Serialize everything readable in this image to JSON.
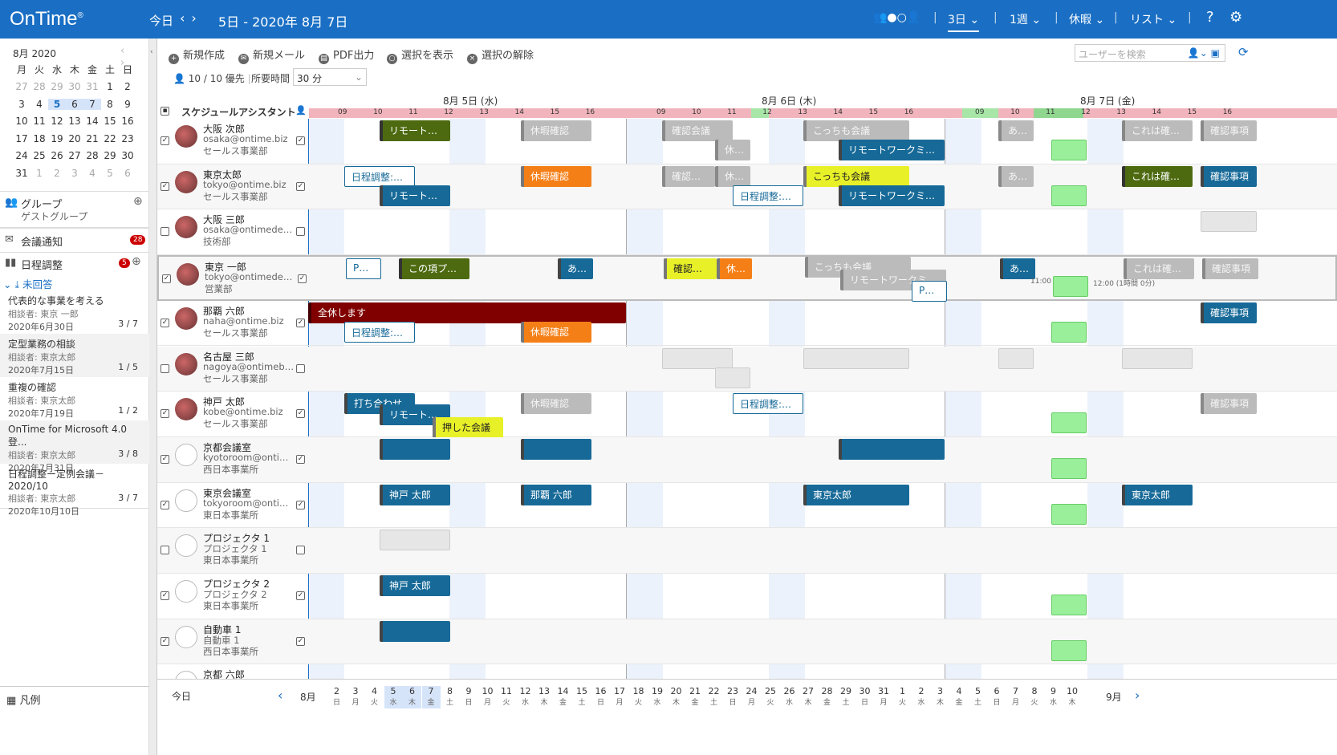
{
  "header": {
    "logo": "OnTime",
    "reg": "®",
    "today": "今日",
    "prev": "‹",
    "next": "›",
    "range": "5日 - 2020年 8月 7日",
    "view3": "3日",
    "week": "1週",
    "vacation": "休暇",
    "list": "リスト",
    "help": "?"
  },
  "minical": {
    "title": "8月 2020",
    "weekdays": [
      "月",
      "火",
      "水",
      "木",
      "金",
      "土",
      "日"
    ],
    "weeks": [
      [
        "27",
        "28",
        "29",
        "30",
        "31",
        "1",
        "2"
      ],
      [
        "3",
        "4",
        "5",
        "6",
        "7",
        "8",
        "9"
      ],
      [
        "10",
        "11",
        "12",
        "13",
        "14",
        "15",
        "16"
      ],
      [
        "17",
        "18",
        "19",
        "20",
        "21",
        "22",
        "23"
      ],
      [
        "24",
        "25",
        "26",
        "27",
        "28",
        "29",
        "30"
      ],
      [
        "31",
        "1",
        "2",
        "3",
        "4",
        "5",
        "6"
      ]
    ]
  },
  "sidebar": {
    "group": "グループ",
    "group_sub": "ゲストグループ",
    "meeting": "会議通知",
    "meeting_count": "28",
    "schedule": "日程調整",
    "schedule_count": "5",
    "unanswered": "未回答",
    "todos": [
      {
        "title": "代表的な事業を考える",
        "sub": "相談者: 東京 一郎",
        "date": "2020年6月30日",
        "count": "3 / 7"
      },
      {
        "title": "定型業務の相談",
        "sub": "相談者: 東京太郎",
        "date": "2020年7月15日",
        "count": "1 / 5"
      },
      {
        "title": "重複の確認",
        "sub": "相談者: 東京太郎",
        "date": "2020年7月19日",
        "count": "1 / 2"
      },
      {
        "title": "OnTime for Microsoft 4.0 登...",
        "sub": "相談者: 東京太郎",
        "date": "2020年7月31日",
        "count": "3 / 8"
      },
      {
        "title": "日程調整ー定例会議－2020/10",
        "sub": "相談者: 東京太郎",
        "date": "2020年10月10日",
        "count": "3 / 7"
      }
    ],
    "legend": "凡例"
  },
  "toolbar": {
    "new": "新規作成",
    "mail": "新規メール",
    "pdf": "PDF出力",
    "show": "選択を表示",
    "clear": "選択の解除",
    "search_placeholder": "ユーザーを検索",
    "priority": "10 / 10 優先",
    "duration_label": "所要時間",
    "duration": "30 分"
  },
  "grid": {
    "title": "スケジュールアシスタント",
    "days": [
      "8月 5日 (水)",
      "8月 6日 (木)",
      "8月 7日 (金)"
    ],
    "hours": [
      "09",
      "10",
      "11",
      "12",
      "13",
      "14",
      "15",
      "16"
    ]
  },
  "people": [
    {
      "name": "大阪 次郎",
      "mail": "osaka@ontime.biz",
      "dept": "セールス事業部"
    },
    {
      "name": "東京太郎",
      "mail": "tokyo@ontime.biz",
      "dept": "セールス事業部"
    },
    {
      "name": "大阪 三郎",
      "mail": "osaka@ontimedem...",
      "dept": "技術部"
    },
    {
      "name": "東京 一郎",
      "mail": "tokyo@ontimedem...",
      "dept": "営業部"
    },
    {
      "name": "那覇 六郎",
      "mail": "naha@ontime.biz",
      "dept": "セールス事業部"
    },
    {
      "name": "名古屋 三郎",
      "mail": "nagoya@ontimebiz...",
      "dept": "セールス事業部"
    },
    {
      "name": "神戸 太郎",
      "mail": "kobe@ontime.biz",
      "dept": "セールス事業部"
    },
    {
      "name": "京都会議室",
      "mail": "kyotoroom@ontim...",
      "dept": "西日本事業所"
    },
    {
      "name": "東京会議室",
      "mail": "tokyoroom@ontim...",
      "dept": "東日本事業所"
    },
    {
      "name": "プロジェクタ 1",
      "mail": "プロジェクタ 1",
      "dept": "東日本事業所"
    },
    {
      "name": "プロジェクタ 2",
      "mail": "プロジェクタ 2",
      "dept": "東日本事業所"
    },
    {
      "name": "自動車 1",
      "mail": "自動車 1",
      "dept": "西日本事業所"
    },
    {
      "name": "京都 六郎",
      "mail": "",
      "dept": ""
    }
  ],
  "events": {
    "remote": "リモートワー...",
    "vac": "休暇確認",
    "confirm": "確認会議",
    "kyu": "休暇...",
    "kocchi": "こっちも会議",
    "rwm": "リモートワークミーテ...",
    "aa": "ああ...",
    "kore": "これは確認プ...",
    "kakunin": "確認事項",
    "nittei": "日程調整:On...",
    "pol": "POL...",
    "kono": "この項プロジ...",
    "aaa": "あああ",
    "all": "全休します",
    "uchi": "打ち合わせ",
    "oshi": "押した会議",
    "kobe": "神戸 太郎",
    "naha": "那覇 六郎",
    "tokyo": "東京太郎",
    "t1100": "11:00",
    "t1200": "12:00 (1時間 0分)"
  },
  "bottom": {
    "today": "今日",
    "aug": "8月",
    "sep": "9月",
    "days": [
      [
        "2",
        "日"
      ],
      [
        "3",
        "月"
      ],
      [
        "4",
        "火"
      ],
      [
        "5",
        "水"
      ],
      [
        "6",
        "木"
      ],
      [
        "7",
        "金"
      ],
      [
        "8",
        "土"
      ],
      [
        "9",
        "日"
      ],
      [
        "10",
        "月"
      ],
      [
        "11",
        "火"
      ],
      [
        "12",
        "水"
      ],
      [
        "13",
        "木"
      ],
      [
        "14",
        "金"
      ],
      [
        "15",
        "土"
      ],
      [
        "16",
        "日"
      ],
      [
        "17",
        "月"
      ],
      [
        "18",
        "火"
      ],
      [
        "19",
        "水"
      ],
      [
        "20",
        "木"
      ],
      [
        "21",
        "金"
      ],
      [
        "22",
        "土"
      ],
      [
        "23",
        "日"
      ],
      [
        "24",
        "月"
      ],
      [
        "25",
        "火"
      ],
      [
        "26",
        "水"
      ],
      [
        "27",
        "木"
      ],
      [
        "28",
        "金"
      ],
      [
        "29",
        "土"
      ],
      [
        "30",
        "日"
      ],
      [
        "31",
        "月"
      ],
      [
        "1",
        "火"
      ],
      [
        "2",
        "水"
      ],
      [
        "3",
        "木"
      ],
      [
        "4",
        "金"
      ],
      [
        "5",
        "土"
      ],
      [
        "6",
        "日"
      ],
      [
        "7",
        "月"
      ],
      [
        "8",
        "火"
      ],
      [
        "9",
        "水"
      ],
      [
        "10",
        "木"
      ]
    ]
  },
  "colors": {
    "brand": "#1a6fc4",
    "event_blue": "#176a98",
    "hour_strip": "#f2b4bc"
  }
}
